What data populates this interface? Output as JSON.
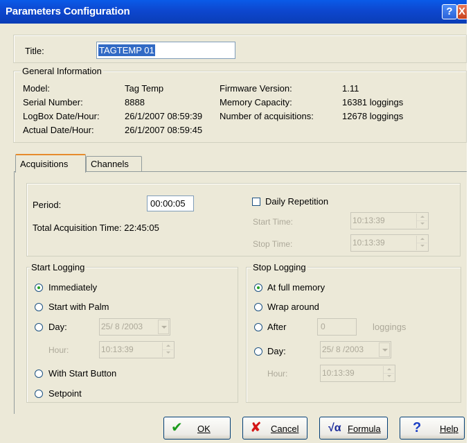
{
  "window": {
    "title": "Parameters Configuration",
    "help_button": "?",
    "close_button": "X"
  },
  "title_field": {
    "label": "Title:",
    "value": "TAGTEMP 01"
  },
  "general": {
    "legend": "General Information",
    "model_label": "Model:",
    "model_value": "Tag Temp",
    "serial_label": "Serial Number:",
    "serial_value": "8888",
    "logbox_label": "LogBox Date/Hour:",
    "logbox_value": "26/1/2007 08:59:39",
    "actual_label": "Actual Date/Hour:",
    "actual_value": "26/1/2007 08:59:45",
    "firmware_label": "Firmware Version:",
    "firmware_value": "1.11",
    "memory_label": "Memory Capacity:",
    "memory_value": "16381 loggings",
    "acq_label": "Number of acquisitions:",
    "acq_value": "12678 loggings"
  },
  "tabs": [
    {
      "label": "Acquisitions",
      "active": true
    },
    {
      "label": "Channels",
      "active": false
    }
  ],
  "acquisition": {
    "period_label": "Period:",
    "period_value": "00:00:05",
    "total_label": "Total Acquisition Time: 22:45:05",
    "daily_label": "Daily Repetition",
    "daily_checked": false,
    "start_time_label": "Start Time:",
    "start_time_value": "10:13:39",
    "stop_time_label": "Stop Time:",
    "stop_time_value": "10:13:39"
  },
  "start_logging": {
    "legend": "Start Logging",
    "immediately": "Immediately",
    "with_palm": "Start with Palm",
    "day": "Day:",
    "day_value": "25/ 8 /2003",
    "hour": "Hour:",
    "hour_value": "10:13:39",
    "with_button": "With Start Button",
    "setpoint": "Setpoint",
    "selected": "immediately"
  },
  "stop_logging": {
    "legend": "Stop Logging",
    "full_memory": "At full memory",
    "wrap_around": "Wrap around",
    "after": "After",
    "after_value": "0",
    "after_unit": "loggings",
    "day": "Day:",
    "day_value": "25/ 8 /2003",
    "hour": "Hour:",
    "hour_value": "10:13:39",
    "selected": "full_memory"
  },
  "buttons": {
    "ok": "OK",
    "cancel": "Cancel",
    "formula": "Formula",
    "help": "Help",
    "ok_icon": "checkmark-icon",
    "cancel_icon": "red-x-icon",
    "formula_icon": "square-root-icon",
    "help_icon": "question-icon"
  },
  "colors": {
    "titlebar": "#0a47cf",
    "dialog_bg": "#ece9d8",
    "selection": "#316ac5",
    "tab_highlight": "#e68b2c",
    "radio_dot": "#21a121"
  }
}
